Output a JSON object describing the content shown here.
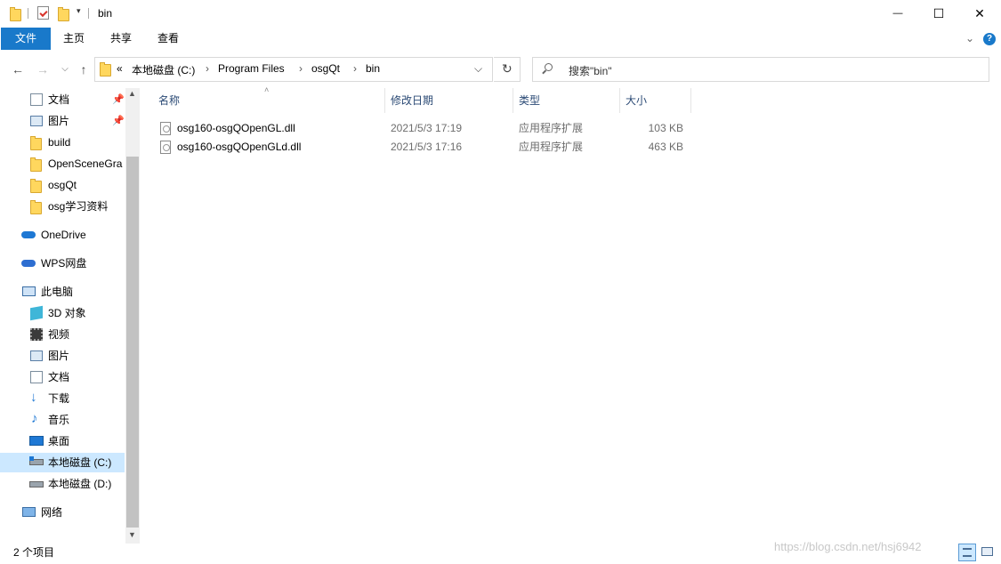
{
  "window": {
    "title": "bin",
    "minimize": "—",
    "maximize": "☐",
    "close": "✕"
  },
  "ribbon": {
    "tabs": [
      "文件",
      "主页",
      "共享",
      "查看"
    ],
    "active_tab": "文件",
    "collapse_icon": "chevron-down-icon",
    "help_label": "?"
  },
  "address": {
    "overflow": "«",
    "crumbs": [
      "本地磁盘 (C:)",
      "Program Files",
      "osgQt",
      "bin"
    ],
    "dropdown_glyph": "⌵",
    "refresh_glyph": "↻"
  },
  "search": {
    "placeholder": "搜索\"bin\""
  },
  "nav": {
    "quick_access": [
      {
        "label": "文档",
        "icon": "document-icon",
        "pinned": true
      },
      {
        "label": "图片",
        "icon": "pictures-icon",
        "pinned": true
      },
      {
        "label": "build",
        "icon": "folder-icon",
        "pinned": false
      },
      {
        "label": "OpenSceneGra",
        "icon": "folder-icon",
        "pinned": false
      },
      {
        "label": "osgQt",
        "icon": "folder-icon",
        "pinned": false
      },
      {
        "label": "osg学习资料",
        "icon": "folder-icon",
        "pinned": false
      }
    ],
    "onedrive": "OneDrive",
    "wps": "WPS网盘",
    "this_pc": "此电脑",
    "pc_items": [
      {
        "label": "3D 对象",
        "icon": "3d-objects-icon"
      },
      {
        "label": "视频",
        "icon": "videos-icon"
      },
      {
        "label": "图片",
        "icon": "pictures-icon"
      },
      {
        "label": "文档",
        "icon": "document-icon"
      },
      {
        "label": "下载",
        "icon": "download-icon"
      },
      {
        "label": "音乐",
        "icon": "music-icon"
      },
      {
        "label": "桌面",
        "icon": "desktop-icon"
      },
      {
        "label": "本地磁盘 (C:)",
        "icon": "drive-c-icon",
        "selected": true
      },
      {
        "label": "本地磁盘 (D:)",
        "icon": "drive-d-icon"
      }
    ],
    "network": "网络"
  },
  "columns": {
    "name": "名称",
    "date": "修改日期",
    "type": "类型",
    "size": "大小"
  },
  "files": [
    {
      "name": "osg160-osgQOpenGL.dll",
      "date": "2021/5/3 17:19",
      "type": "应用程序扩展",
      "size": "103 KB"
    },
    {
      "name": "osg160-osgQOpenGLd.dll",
      "date": "2021/5/3 17:16",
      "type": "应用程序扩展",
      "size": "463 KB"
    }
  ],
  "status": {
    "count": "2 个项目"
  },
  "watermark": "https://blog.csdn.net/hsj6942"
}
